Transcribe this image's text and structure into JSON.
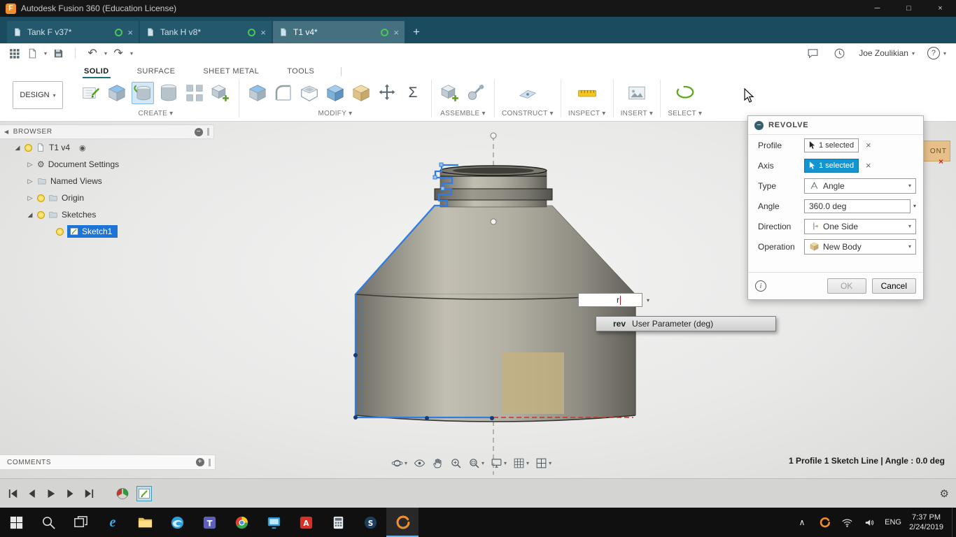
{
  "icons": {
    "chevron_down": "▾",
    "close": "×",
    "minimize": "─",
    "maximize": "□",
    "plus": "+",
    "minus": "−",
    "collapse_left": "◀",
    "tri_collapsed": "▷",
    "tri_expanded": "◢",
    "gear": "⚙",
    "record_dot": "◉",
    "sigma": "Σ",
    "question": "?",
    "undo": "↶",
    "redo": "↷",
    "info": "i",
    "caret_up": "∧"
  },
  "colors": {
    "accent_blue": "#0696d7",
    "selection_blue": "#1b74d6",
    "fusion_orange": "#f18f2c",
    "sketch_green": "#57a11e",
    "profile_blue": "#2f7de2"
  },
  "titlebar": {
    "app_title": "Autodesk Fusion 360 (Education License)"
  },
  "doc_tabs": [
    {
      "label": "Tank F v37*"
    },
    {
      "label": "Tank H v8*"
    },
    {
      "label": "T1 v4*"
    }
  ],
  "qat": {
    "user_name": "Joe Zoulikian"
  },
  "ribbon": {
    "workspace_label": "DESIGN",
    "tabs": [
      {
        "label": "SOLID"
      },
      {
        "label": "SURFACE"
      },
      {
        "label": "SHEET METAL"
      },
      {
        "label": "TOOLS"
      }
    ],
    "groups": [
      {
        "label": "CREATE"
      },
      {
        "label": "MODIFY"
      },
      {
        "label": "ASSEMBLE"
      },
      {
        "label": "CONSTRUCT"
      },
      {
        "label": "INSPECT"
      },
      {
        "label": "INSERT"
      },
      {
        "label": "SELECT"
      }
    ]
  },
  "browser": {
    "header": "BROWSER",
    "root_label": "T1 v4",
    "items": [
      {
        "label": "Document Settings"
      },
      {
        "label": "Named Views"
      },
      {
        "label": "Origin"
      },
      {
        "label": "Sketches"
      },
      {
        "label": "Sketch1"
      }
    ]
  },
  "revolve": {
    "title": "REVOLVE",
    "profile_label": "Profile",
    "profile_value": "1 selected",
    "axis_label": "Axis",
    "axis_value": "1 selected",
    "type_label": "Type",
    "type_value": "Angle",
    "angle_label": "Angle",
    "angle_value": "360.0 deg",
    "direction_label": "Direction",
    "direction_value": "One Side",
    "operation_label": "Operation",
    "operation_value": "New Body",
    "ok_label": "OK",
    "cancel_label": "Cancel"
  },
  "viewcube": {
    "visible_text": "ONT"
  },
  "param_popup": {
    "input_value": "r",
    "suggestion_name": "rev",
    "suggestion_desc": "User Parameter (deg)"
  },
  "comments": {
    "label": "COMMENTS"
  },
  "statusbar": {
    "text": "1 Profile 1 Sketch Line | Angle : 0.0 deg"
  },
  "taskbar": {
    "language": "ENG",
    "time": "7:37 PM",
    "date": "2/24/2019"
  }
}
